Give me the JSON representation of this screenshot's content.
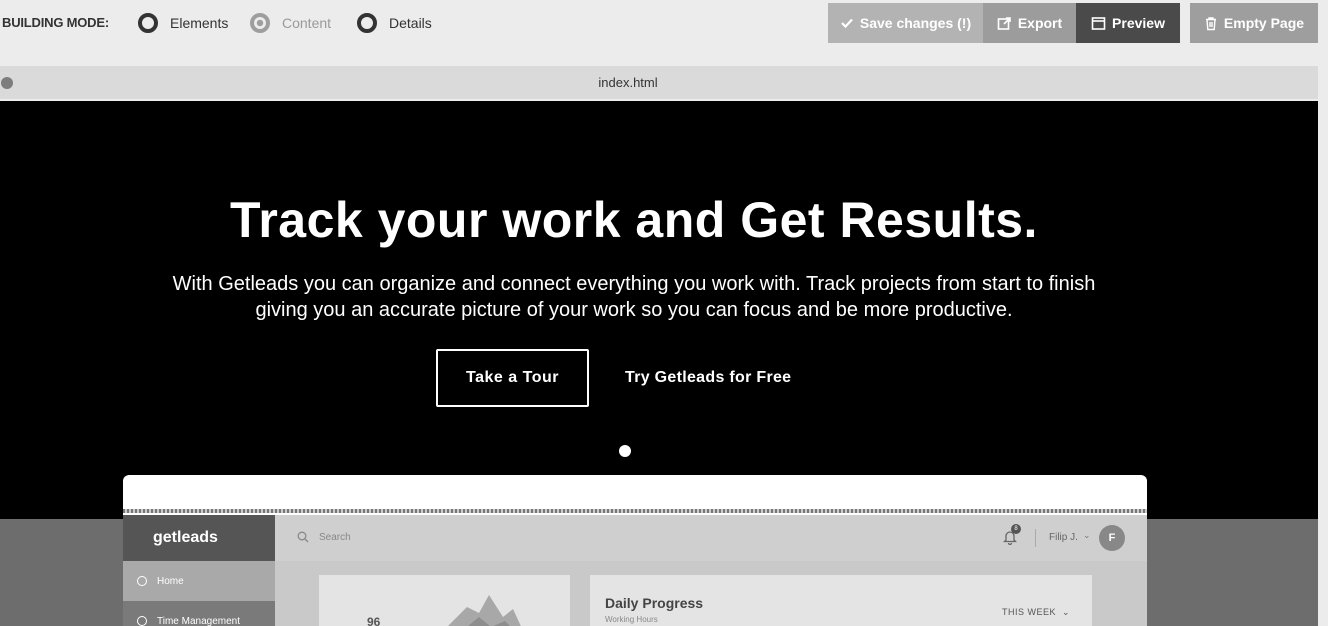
{
  "toolbar": {
    "mode_label": "BUILDING MODE:",
    "modes": [
      {
        "label": "Elements",
        "selected": false
      },
      {
        "label": "Content",
        "selected": true
      },
      {
        "label": "Details",
        "selected": false
      }
    ],
    "save_label": "Save changes (!)",
    "export_label": "Export",
    "preview_label": "Preview",
    "empty_label": "Empty Page"
  },
  "file": {
    "name": "index.html"
  },
  "hero": {
    "title": "Track your work and Get Results.",
    "subtitle": "With Getleads you can organize and connect everything you work with. Track projects from start to finish giving you an accurate picture of your work so you can focus and be more productive.",
    "tour_label": "Take a Tour",
    "free_label": "Try Getleads for Free"
  },
  "app": {
    "logo": "getleads",
    "nav": [
      "Home",
      "Time Management"
    ],
    "search_placeholder": "Search",
    "notif_count": "8",
    "user": "Filip J.",
    "avatar_initial": "F",
    "stat_value": "96",
    "progress_title": "Daily Progress",
    "progress_sub": "Working Hours",
    "range": "THIS WEEK"
  },
  "colors": {
    "accent_dark": "#4a4a4a",
    "hero_bg": "#000000"
  }
}
